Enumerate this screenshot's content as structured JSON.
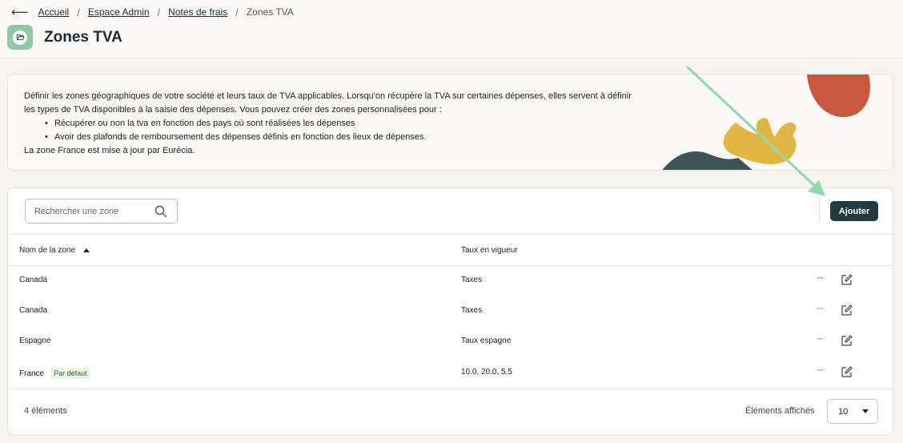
{
  "breadcrumb": {
    "back_icon": "arrow-left-icon",
    "items": [
      "Accueil",
      "Espace Admin",
      "Notes de frais"
    ],
    "current": "Zones TVA"
  },
  "page": {
    "title": "Zones TVA",
    "icon": "folder-open-icon",
    "icon_color": "#8fcaa6"
  },
  "info": {
    "line1": "Définir les zones géographiques de votre société et leurs taux de TVA applicables. Lorsqu'on récupère la TVA sur certaines dépenses, elles servent à définir les types de TVA disponibles à la saisie des dépenses. Vous pouvez créer des zones personnalisées pour :",
    "bullets": [
      "Récupérer ou non la tva en fonction des pays où sont réalisées les dépenses",
      "Avoir des plafonds de remboursement des dépenses définis en fonction des lieux de dépenses."
    ],
    "line2": "La zone France est mise à jour par Eurécia."
  },
  "toolbar": {
    "search_placeholder": "Rechercher une zone",
    "search_value": "",
    "add_label": "Ajouter",
    "add_color": "#233a40"
  },
  "table": {
    "columns": {
      "name": "Nom de la zone",
      "rate": "Taux en vigueur"
    },
    "sort": "ascending",
    "rows": [
      {
        "name": "Canada",
        "rate": "Taxes",
        "badge": ""
      },
      {
        "name": "Canada",
        "rate": "Taxes",
        "badge": ""
      },
      {
        "name": "Espagne",
        "rate": "Taux espagne",
        "badge": ""
      },
      {
        "name": "France",
        "rate": "10.0, 20.0, 5.5",
        "badge": "Par défaut"
      }
    ],
    "more_label": "···"
  },
  "footer": {
    "count": "4 éléments",
    "per_page_label": "Éléments affichés",
    "per_page_value": "10"
  },
  "colors": {
    "accent_dark": "#233a40",
    "badge_bg": "#eef4ea",
    "badge_text": "#2f6b2f",
    "annotation_arrow": "#8fd9a8"
  }
}
